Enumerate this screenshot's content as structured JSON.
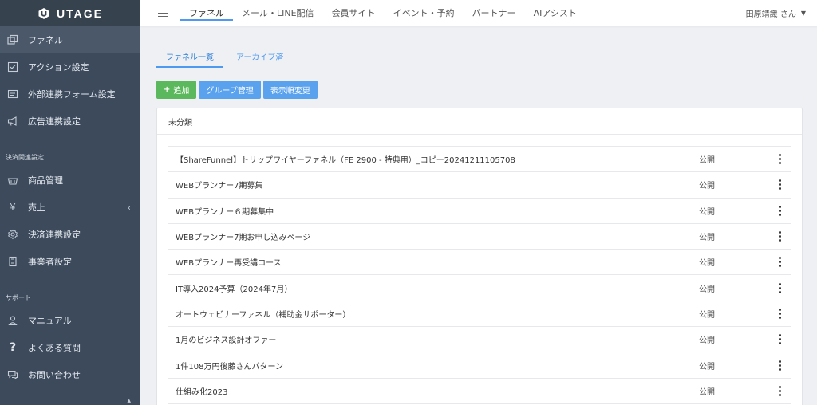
{
  "app": {
    "logo_text": "UTAGE"
  },
  "sidebar": {
    "items": [
      {
        "label": "ファネル",
        "icon": "funnel-icon",
        "active": true
      },
      {
        "label": "アクション設定",
        "icon": "checklist-icon"
      },
      {
        "label": "外部連携フォーム設定",
        "icon": "form-icon"
      },
      {
        "label": "広告連携設定",
        "icon": "megaphone-icon"
      }
    ],
    "section_payment": "決済関連設定",
    "payment_items": [
      {
        "label": "商品管理",
        "icon": "basket-icon"
      },
      {
        "label": "売上",
        "icon": "yen-icon",
        "caret": "‹"
      },
      {
        "label": "決済連携設定",
        "icon": "gear-icon"
      },
      {
        "label": "事業者設定",
        "icon": "building-icon"
      }
    ],
    "section_support": "サポート",
    "support_items": [
      {
        "label": "マニュアル",
        "icon": "person-icon"
      },
      {
        "label": "よくある質問",
        "icon": "question-icon"
      },
      {
        "label": "お問い合わせ",
        "icon": "chat-icon"
      }
    ]
  },
  "topnav": {
    "items": [
      "ファネル",
      "メール・LINE配信",
      "会員サイト",
      "イベント・予約",
      "パートナー",
      "AIアシスト"
    ],
    "user_name": "田原靖識 さん"
  },
  "main": {
    "tabs": [
      "ファネル一覧",
      "アーカイブ済"
    ],
    "buttons": {
      "add": "追加",
      "group": "グループ管理",
      "order": "表示順変更"
    },
    "panel_title": "未分類",
    "rows": [
      {
        "name": "【ShareFunnel】トリップワイヤーファネル（FE 2900 - 特典用）_コピー20241211105708",
        "status": "公開"
      },
      {
        "name": "WEBプランナー7期募集",
        "status": "公開"
      },
      {
        "name": "WEBプランナー６期募集中",
        "status": "公開"
      },
      {
        "name": "WEBプランナー7期お申し込みページ",
        "status": "公開"
      },
      {
        "name": "WEBプランナー再受講コース",
        "status": "公開"
      },
      {
        "name": "IT導入2024予算（2024年7月）",
        "status": "公開"
      },
      {
        "name": "オートウェビナーファネル（補助金サポーター）",
        "status": "公開"
      },
      {
        "name": "1月のビジネス設計オファー",
        "status": "公開"
      },
      {
        "name": "1件108万円後藤さんパターン",
        "status": "公開"
      },
      {
        "name": "仕組み化2023",
        "status": "公開"
      }
    ]
  },
  "colors": {
    "sidebar": "#3c4a5c",
    "accent": "#4e9af1",
    "add_button": "#5cb85c"
  }
}
